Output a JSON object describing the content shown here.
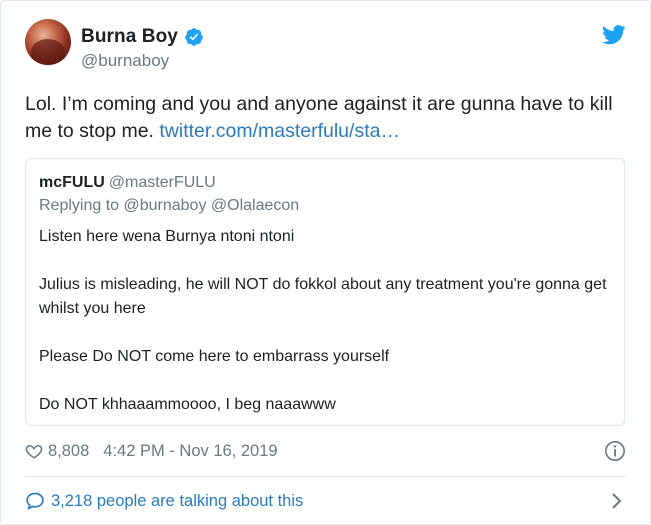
{
  "author": {
    "display_name": "Burna Boy",
    "handle": "@burnaboy",
    "verified": true
  },
  "tweet": {
    "text": "Lol. I’m coming and you and anyone against it are gunna have to kill me to stop me. ",
    "link": "twitter.com/masterfulu/sta…"
  },
  "quoted_tweet": {
    "display_name": "mcFULU",
    "handle": "@masterFULU",
    "replying_to": "Replying to @burnaboy @Olalaecon",
    "paragraphs": [
      "Listen here wena Burnya ntoni ntoni",
      "Julius is misleading, he will NOT do fokkol about any treatment you're gonna get whilst you here",
      "Please Do NOT come here to embarrass yourself",
      "Do NOT khhaaammoooo, I beg naaawww"
    ]
  },
  "meta": {
    "likes": "8,808",
    "timestamp": "4:42 PM - Nov 16, 2019"
  },
  "conversation": {
    "label": "3,218 people are talking about this"
  },
  "icons": {
    "verified": "verified-badge-icon",
    "bird": "twitter-bird-icon",
    "heart": "heart-icon",
    "info": "info-icon",
    "bubble": "speech-bubble-icon",
    "chevron": "chevron-right-icon"
  },
  "colors": {
    "link": "#2b7bb9",
    "twitter_blue": "#1da1f2",
    "secondary_text": "#697882",
    "border": "#e1e8ed"
  }
}
